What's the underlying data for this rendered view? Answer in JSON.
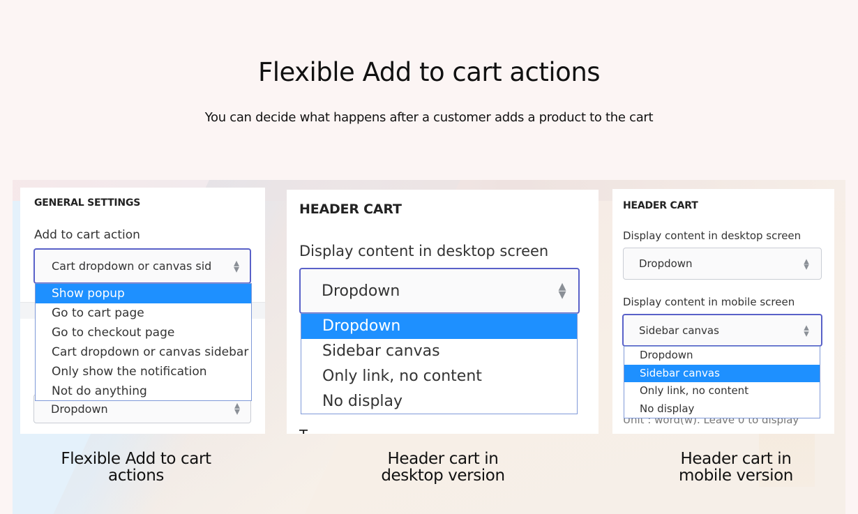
{
  "hero": {
    "title": "Flexible Add to cart actions",
    "subtitle": "You can decide what happens after a customer adds a product to the cart"
  },
  "colors": {
    "page_bg": "#fcf5f4",
    "selected_option_bg": "#1e90ff",
    "focus_border": "#5961c8",
    "listbox_border": "#7f99d8"
  },
  "panels": {
    "general_settings": {
      "heading": "GENERAL SETTINGS",
      "field_label": "Add to cart action",
      "select_value": "Cart dropdown or canvas sid",
      "select_icon": "updown-arrows-icon",
      "options": [
        {
          "label": "Show popup",
          "highlighted": true
        },
        {
          "label": "Go to cart page",
          "highlighted": false
        },
        {
          "label": "Go to checkout page",
          "highlighted": false
        },
        {
          "label": "Cart dropdown or canvas sidebar",
          "highlighted": false
        },
        {
          "label": "Only show the notification",
          "highlighted": false
        },
        {
          "label": "Not do anything",
          "highlighted": false
        }
      ],
      "second_select_value": "Dropdown"
    },
    "header_cart_desktop": {
      "heading": "HEADER CART",
      "field_label": "Display content in desktop screen",
      "select_value": "Dropdown",
      "select_icon": "updown-arrows-icon",
      "options": [
        {
          "label": "Dropdown",
          "highlighted": true
        },
        {
          "label": "Sidebar canvas",
          "highlighted": false
        },
        {
          "label": "Only link, no content",
          "highlighted": false
        },
        {
          "label": "No display",
          "highlighted": false
        }
      ],
      "cut_text": "T"
    },
    "header_cart_mobile": {
      "heading": "HEADER CART",
      "desktop_label": "Display content in desktop screen",
      "desktop_value": "Dropdown",
      "mobile_label": "Display content in mobile screen",
      "mobile_value": "Sidebar canvas",
      "select_icon": "updown-arrows-icon",
      "options": [
        {
          "label": "Dropdown",
          "highlighted": false
        },
        {
          "label": "Sidebar canvas",
          "highlighted": true
        },
        {
          "label": "Only link, no content",
          "highlighted": false
        },
        {
          "label": "No display",
          "highlighted": false
        }
      ],
      "hint": "Unit : word(w). Leave 0 to display"
    }
  },
  "captions": [
    {
      "line1": "Flexible Add to cart",
      "line2": "actions"
    },
    {
      "line1": "Header cart in",
      "line2": "desktop version"
    },
    {
      "line1": "Header cart in",
      "line2": "mobile version"
    }
  ]
}
